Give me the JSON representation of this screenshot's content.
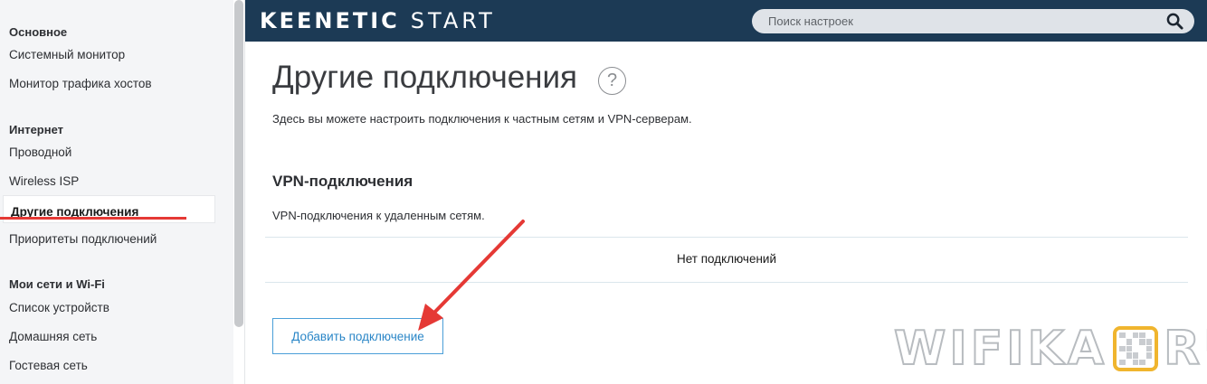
{
  "sidebar": {
    "sections": [
      {
        "title": "Основное",
        "items": [
          "Системный монитор",
          "Монитор трафика хостов"
        ]
      },
      {
        "title": "Интернет",
        "items": [
          "Проводной",
          "Wireless ISP",
          "Другие подключения",
          "Приоритеты подключений"
        ]
      },
      {
        "title": "Мои сети и Wi-Fi",
        "items": [
          "Список устройств",
          "Домашняя сеть",
          "Гостевая сеть"
        ]
      }
    ],
    "active_item": "Другие подключения"
  },
  "header": {
    "brand": "KEENETIC",
    "product": "START",
    "search": {
      "placeholder": "Поиск настроек",
      "value": ""
    },
    "icons": {
      "search": "search-icon"
    }
  },
  "main": {
    "title": "Другие подключения",
    "help_icon_label": "?",
    "description": "Здесь вы можете настроить подключения к частным сетям и VPN-серверам.",
    "vpn_section": {
      "heading": "VPN-подключения",
      "description": "VPN-подключения к удаленным сетям.",
      "empty_state": "Нет подключений",
      "add_button_label": "Добавить подключение"
    }
  },
  "watermark": {
    "left": "WIFIKA",
    "right": "RU"
  },
  "colors": {
    "header_bg": "#1c3a55",
    "accent_blue": "#2a86c7",
    "annotation_red": "#e53935",
    "sidebar_bg": "#f4f5f7"
  }
}
